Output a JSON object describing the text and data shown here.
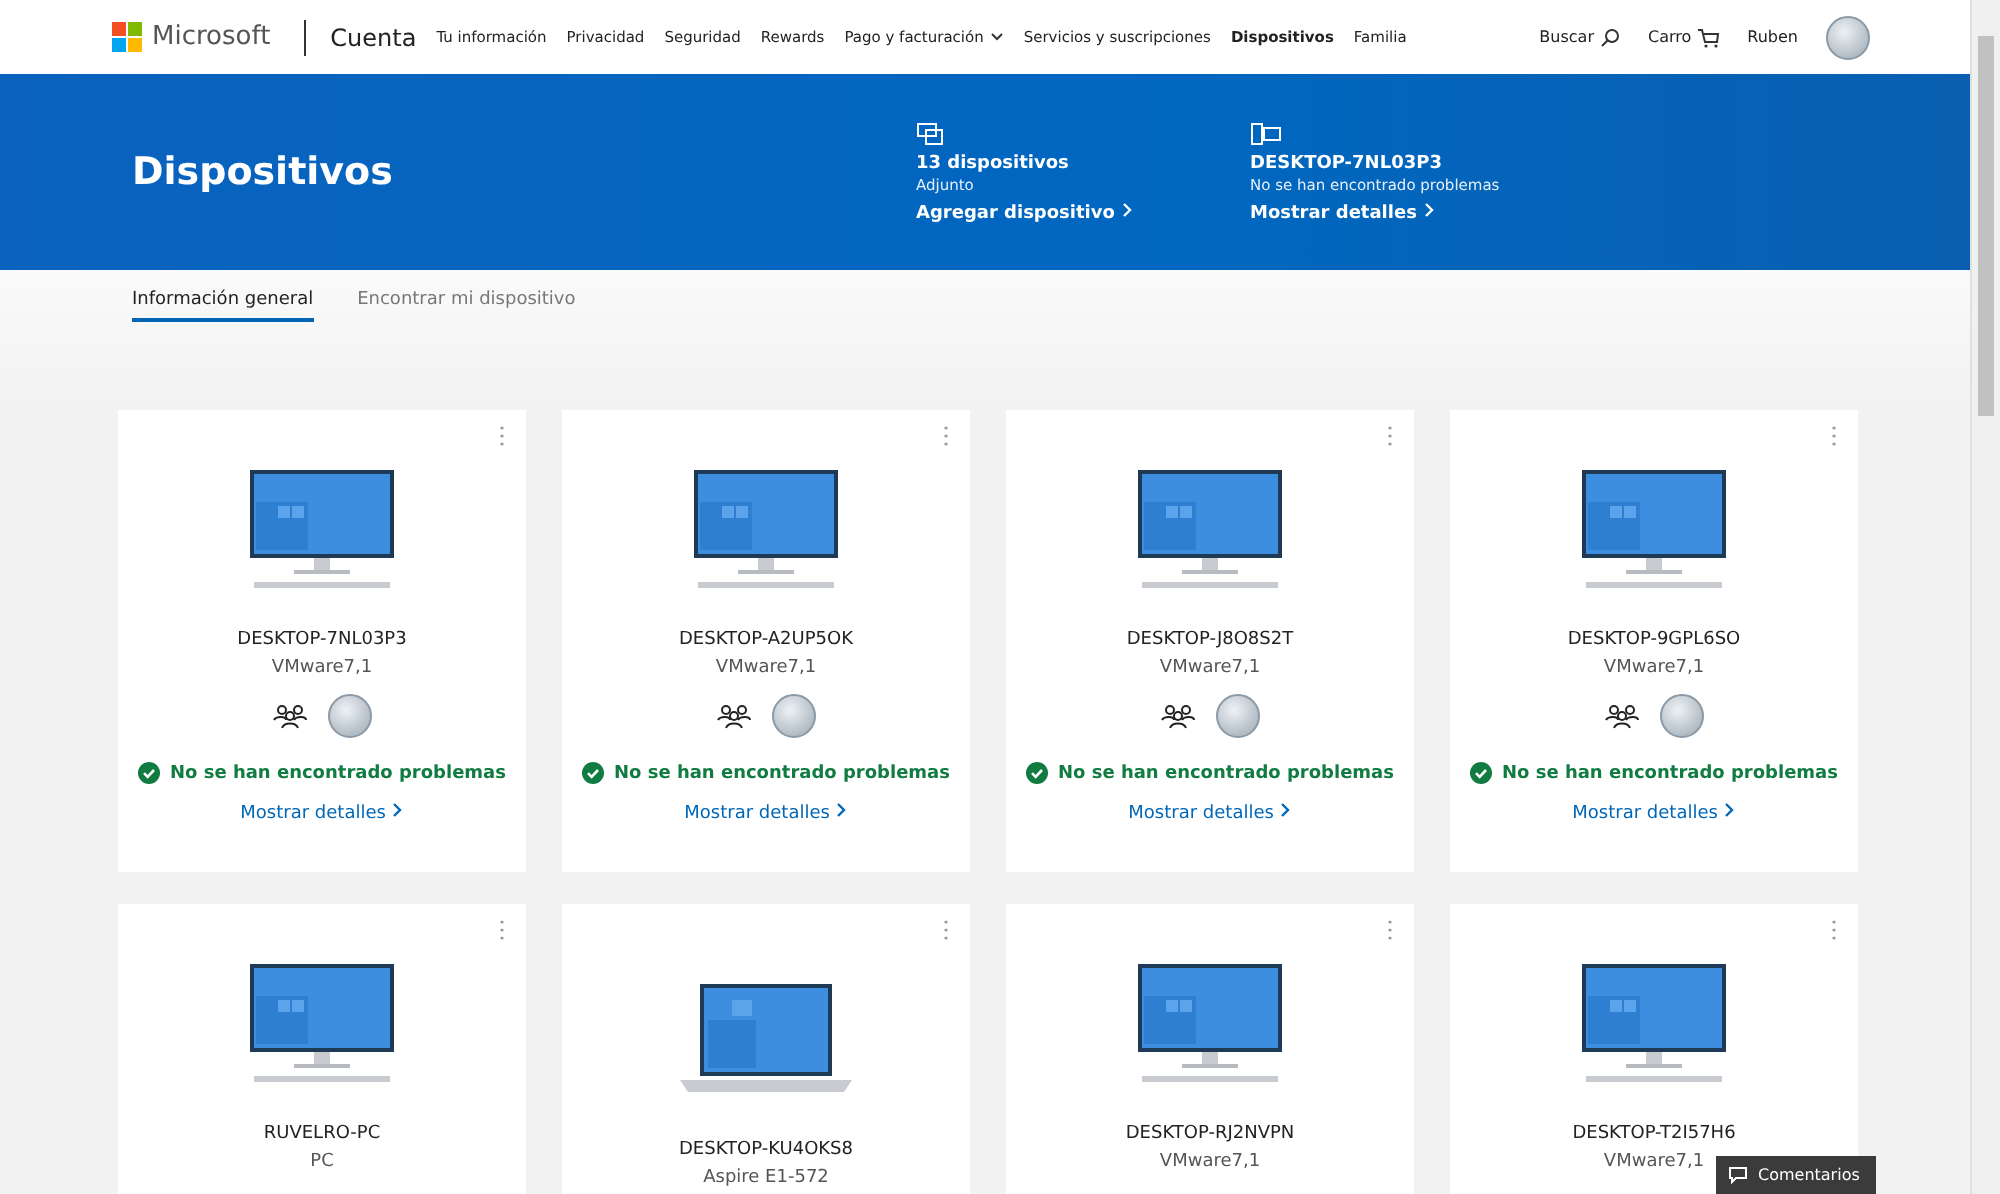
{
  "header": {
    "brand": "Microsoft",
    "section": "Cuenta",
    "nav": [
      {
        "label": "Tu información",
        "selected": false,
        "dropdown": false
      },
      {
        "label": "Privacidad",
        "selected": false,
        "dropdown": false
      },
      {
        "label": "Seguridad",
        "selected": false,
        "dropdown": false
      },
      {
        "label": "Rewards",
        "selected": false,
        "dropdown": false
      },
      {
        "label": "Pago y facturación",
        "selected": false,
        "dropdown": true
      },
      {
        "label": "Servicios y suscripciones",
        "selected": false,
        "dropdown": false
      },
      {
        "label": "Dispositivos",
        "selected": true,
        "dropdown": false
      },
      {
        "label": "Familia",
        "selected": false,
        "dropdown": false
      }
    ],
    "search": "Buscar",
    "cart": "Carro",
    "user": "Ruben"
  },
  "banner": {
    "title": "Dispositivos",
    "stats": [
      {
        "kind": "devices",
        "title": "13 dispositivos",
        "subtitle": "Adjunto",
        "link": "Agregar dispositivo"
      },
      {
        "kind": "pc",
        "title": "DESKTOP-7NL03P3",
        "subtitle": "No se han encontrado problemas",
        "link": "Mostrar detalles"
      }
    ]
  },
  "tabs": [
    {
      "label": "Información general",
      "selected": true
    },
    {
      "label": "Encontrar mi dispositivo",
      "selected": false
    }
  ],
  "devices": [
    {
      "kind": "desktop",
      "name": "DESKTOP-7NL03P3",
      "model": "VMware7,1",
      "status": "No se han encontrado problemas",
      "link": "Mostrar detalles"
    },
    {
      "kind": "desktop",
      "name": "DESKTOP-A2UP5OK",
      "model": "VMware7,1",
      "status": "No se han encontrado problemas",
      "link": "Mostrar detalles"
    },
    {
      "kind": "desktop",
      "name": "DESKTOP-J8O8S2T",
      "model": "VMware7,1",
      "status": "No se han encontrado problemas",
      "link": "Mostrar detalles"
    },
    {
      "kind": "desktop",
      "name": "DESKTOP-9GPL6SO",
      "model": "VMware7,1",
      "status": "No se han encontrado problemas",
      "link": "Mostrar detalles"
    },
    {
      "kind": "desktop",
      "name": "RUVELRO-PC",
      "model": "PC"
    },
    {
      "kind": "laptop",
      "name": "DESKTOP-KU4OKS8",
      "model": "Aspire E1-572"
    },
    {
      "kind": "desktop",
      "name": "DESKTOP-RJ2NVPN",
      "model": "VMware7,1"
    },
    {
      "kind": "desktop",
      "name": "DESKTOP-T2I57H6",
      "model": "VMware7,1"
    }
  ],
  "feedback": "Comentarios"
}
